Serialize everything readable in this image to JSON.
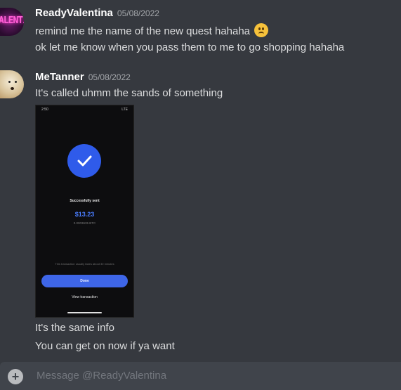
{
  "messages": [
    {
      "username": "ReadyValentina",
      "timestamp": "05/08/2022",
      "avatar_text": "ALENTIN",
      "lines": [
        "remind me the name of the new quest hahaha",
        "ok let me know when you pass them to me to go shopping hahaha"
      ]
    },
    {
      "username": "MeTanner",
      "timestamp": "05/08/2022",
      "lines": [
        "It's called uhmm the sands of something",
        "It's the same info",
        "You can get on now if ya want"
      ],
      "attachment": {
        "status_time": "2:50",
        "status_right": "LTE",
        "title": "Successfully sent",
        "amount": "$13.23",
        "btc": "0.0003635 BTC",
        "note": "This transaction usually takes about 30 minutes",
        "done_label": "Done",
        "view_label": "View transaction"
      }
    }
  ],
  "composer": {
    "placeholder": "Message @ReadyValentina"
  },
  "colors": {
    "background": "#36393f",
    "input": "#40444b",
    "accent": "#3e66e8"
  },
  "icons": {
    "emoji": "frowning-face-icon",
    "add": "plus-circle-icon",
    "check": "check-icon"
  }
}
